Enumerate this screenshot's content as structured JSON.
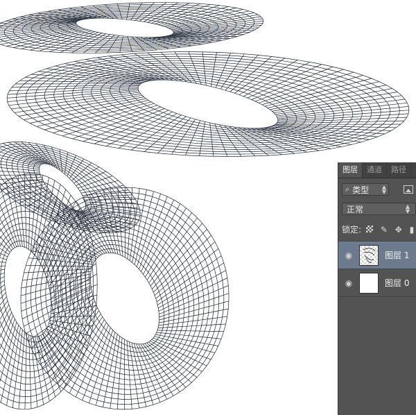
{
  "panel": {
    "tabs": [
      {
        "label": "图层",
        "active": true
      },
      {
        "label": "通道",
        "active": false
      },
      {
        "label": "路径",
        "active": false
      }
    ],
    "filter": {
      "icon": "search-icon",
      "label": "类型"
    },
    "blend_mode": "正常",
    "lock": {
      "label": "锁定:",
      "icons": [
        "lock-transparent-icon",
        "lock-brush-icon",
        "lock-move-icon",
        "lock-all-icon"
      ]
    },
    "layers": [
      {
        "name": "图层 1",
        "selected": true,
        "visible": true,
        "thumbnail": "wireframe"
      },
      {
        "name": "图层 0",
        "selected": false,
        "visible": true,
        "thumbnail": "white"
      }
    ]
  },
  "colors": {
    "panel_bg": "#535353",
    "selected_layer": "#6d7a8e",
    "wire": "#1b2433"
  }
}
